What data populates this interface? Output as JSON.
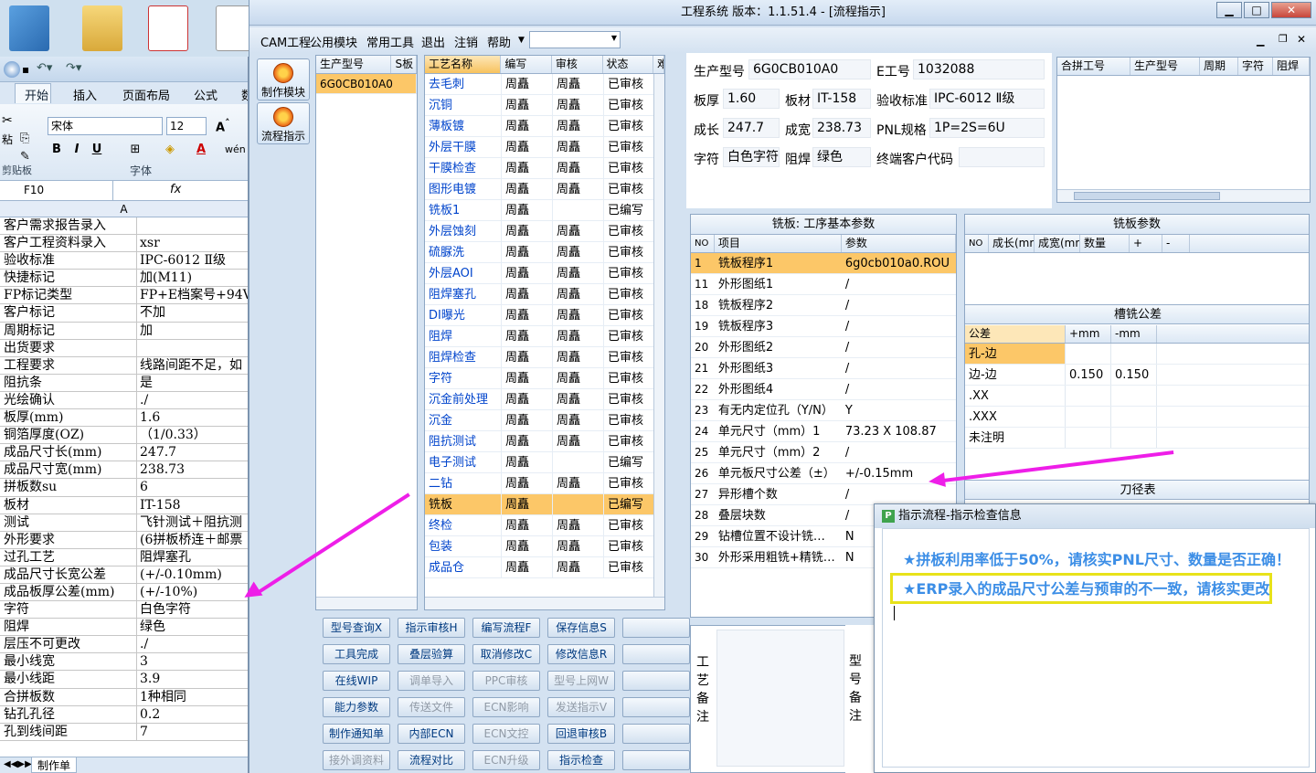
{
  "excel": {
    "font_name": "宋体",
    "font_size": "12",
    "cell_ref": "F10",
    "fx": "fx",
    "col_a": "A",
    "tabs": [
      "开始",
      "插入",
      "页面布局",
      "公式",
      "数"
    ],
    "group_label": "字体",
    "left_label": "剪贴板",
    "paste_label": "粘",
    "sheet_tab": "制作单",
    "rows": [
      [
        "客户需求报告录入",
        ""
      ],
      [
        "客户工程资料录入",
        "xsr"
      ],
      [
        "验收标准",
        "IPC-6012 Ⅱ级"
      ],
      [
        "快捷标记",
        "加(M11)"
      ],
      [
        "FP标记类型",
        "FP+E档案号+94V"
      ],
      [
        "客户标记",
        "不加"
      ],
      [
        "周期标记",
        "加"
      ],
      [
        "出货要求",
        ""
      ],
      [
        "工程要求",
        "线路间距不足，如"
      ],
      [
        "阻抗条",
        "是"
      ],
      [
        "光绘确认",
        "./"
      ],
      [
        "板厚(mm)",
        "1.6"
      ],
      [
        "铜箔厚度(OZ)",
        "（1/0.33）"
      ],
      [
        "成品尺寸长(mm)",
        "247.7"
      ],
      [
        "成品尺寸宽(mm)",
        "238.73"
      ],
      [
        "拼板数su",
        "6"
      ],
      [
        "板材",
        "IT-158"
      ],
      [
        "测试",
        "飞针测试＋阻抗测"
      ],
      [
        "外形要求",
        "(6拼板桥连＋邮票"
      ],
      [
        "过孔工艺",
        "阻焊塞孔"
      ],
      [
        "成品尺寸长宽公差",
        "(+/-0.10mm)"
      ],
      [
        "成品板厚公差(mm)",
        "(+/-10%)"
      ],
      [
        "字符",
        "白色字符"
      ],
      [
        "阻焊",
        "绿色"
      ],
      [
        "层压不可更改",
        "./"
      ],
      [
        "最小线宽",
        "3"
      ],
      [
        "最小线距",
        "3.9"
      ],
      [
        "合拼板数",
        "1种相同"
      ],
      [
        "钻孔孔径",
        "0.2"
      ],
      [
        "孔到线间距",
        "7"
      ]
    ]
  },
  "app": {
    "title": "工程系统   版本：1.1.51.4 - [流程指示]",
    "menu": [
      "CAM工程",
      "公用模块",
      "常用工具",
      "退出",
      "注销",
      "帮助"
    ],
    "sidebar": [
      "制作模块",
      "流程指示"
    ],
    "model_grid": {
      "headers": [
        "生产型号",
        "S板"
      ],
      "rows": [
        [
          "6G0CB010A0",
          ""
        ]
      ]
    },
    "process_grid": {
      "headers": [
        "工艺名称",
        "编写",
        "审核",
        "状态",
        "难"
      ],
      "rows": [
        [
          "去毛刺",
          "周矗",
          "周矗",
          "已审核"
        ],
        [
          "沉铜",
          "周矗",
          "周矗",
          "已审核"
        ],
        [
          "薄板镀",
          "周矗",
          "周矗",
          "已审核"
        ],
        [
          "外层干膜",
          "周矗",
          "周矗",
          "已审核"
        ],
        [
          "干膜检查",
          "周矗",
          "周矗",
          "已审核"
        ],
        [
          "图形电镀",
          "周矗",
          "周矗",
          "已审核"
        ],
        [
          "铣板1",
          "周矗",
          "",
          "已编写"
        ],
        [
          "外层蚀刻",
          "周矗",
          "周矗",
          "已审核"
        ],
        [
          "硫脲洗",
          "周矗",
          "周矗",
          "已审核"
        ],
        [
          "外层AOI",
          "周矗",
          "周矗",
          "已审核"
        ],
        [
          "阻焊塞孔",
          "周矗",
          "周矗",
          "已审核"
        ],
        [
          "DI曝光",
          "周矗",
          "周矗",
          "已审核"
        ],
        [
          "阻焊",
          "周矗",
          "周矗",
          "已审核"
        ],
        [
          "阻焊检查",
          "周矗",
          "周矗",
          "已审核"
        ],
        [
          "字符",
          "周矗",
          "周矗",
          "已审核"
        ],
        [
          "沉金前处理",
          "周矗",
          "周矗",
          "已审核"
        ],
        [
          "沉金",
          "周矗",
          "周矗",
          "已审核"
        ],
        [
          "阻抗测试",
          "周矗",
          "周矗",
          "已审核"
        ],
        [
          "电子测试",
          "周矗",
          "",
          "已编写"
        ],
        [
          "二钻",
          "周矗",
          "周矗",
          "已审核"
        ],
        [
          "铣板",
          "周矗",
          "",
          "已编写"
        ],
        [
          "终检",
          "周矗",
          "周矗",
          "已审核"
        ],
        [
          "包装",
          "周矗",
          "周矗",
          "已审核"
        ],
        [
          "成品仓",
          "周矗",
          "周矗",
          "已审核"
        ]
      ],
      "selected_index": 20
    },
    "buttons": [
      [
        [
          "型号查询X",
          false
        ],
        [
          "指示审核H",
          false
        ],
        [
          "编写流程F",
          false
        ],
        [
          "保存信息S",
          false
        ],
        [
          "",
          false
        ]
      ],
      [
        [
          "工具完成",
          false
        ],
        [
          "叠层验算",
          false
        ],
        [
          "取消修改C",
          false
        ],
        [
          "修改信息R",
          false
        ],
        [
          "",
          false
        ]
      ],
      [
        [
          "在线WIP",
          false
        ],
        [
          "调单导入",
          true
        ],
        [
          "PPC审核",
          true
        ],
        [
          "型号上网W",
          true
        ],
        [
          "",
          false
        ]
      ],
      [
        [
          "能力参数",
          false
        ],
        [
          "传送文件",
          true
        ],
        [
          "ECN影响",
          true
        ],
        [
          "发送指示V",
          true
        ],
        [
          "",
          false
        ]
      ],
      [
        [
          "制作通知单",
          false
        ],
        [
          "内部ECN",
          false
        ],
        [
          "ECN文控",
          true
        ],
        [
          "回退审核B",
          false
        ],
        [
          "",
          false
        ]
      ],
      [
        [
          "接外调资料",
          true
        ],
        [
          "流程对比",
          false
        ],
        [
          "ECN升级",
          true
        ],
        [
          "指示检查",
          false
        ],
        [
          "",
          false
        ]
      ]
    ],
    "info": {
      "model_label": "生产型号",
      "model": "6G0CB010A0",
      "eno_label": "E工号",
      "eno": "1032088",
      "thick_label": "板厚",
      "thick": "1.60",
      "mat_label": "板材",
      "mat": "IT-158",
      "std_label": "验收标准",
      "std": "IPC-6012 Ⅱ级",
      "len_label": "成长",
      "len": "247.7",
      "wid_label": "成宽",
      "wid": "238.73",
      "pnl_label": "PNL规格",
      "pnl": "1P=2S=6U",
      "char_label": "字符",
      "char": "白色字符",
      "mask_label": "阻焊",
      "mask": "绿色",
      "cust_label": "终端客户代码",
      "cust": ""
    },
    "merge_grid": {
      "headers": [
        "合拼工号",
        "生产型号",
        "周期",
        "字符",
        "阻焊"
      ]
    },
    "basic_params": {
      "caption": "铣板: 工序基本参数",
      "headers": [
        "NO",
        "项目",
        "参数"
      ],
      "rows": [
        [
          "1",
          "铣板程序1",
          "6g0cb010a0.ROU"
        ],
        [
          "11",
          "外形图纸1",
          "/"
        ],
        [
          "18",
          "铣板程序2",
          "/"
        ],
        [
          "19",
          "铣板程序3",
          "/"
        ],
        [
          "20",
          "外形图纸2",
          "/"
        ],
        [
          "21",
          "外形图纸3",
          "/"
        ],
        [
          "22",
          "外形图纸4",
          "/"
        ],
        [
          "23",
          "有无内定位孔（Y/N）",
          "Y"
        ],
        [
          "24",
          "单元尺寸（mm）1",
          "73.23 X 108.87"
        ],
        [
          "25",
          "单元尺寸（mm）2",
          "/"
        ],
        [
          "26",
          "单元板尺寸公差（±）",
          "+/-0.15mm"
        ],
        [
          "27",
          "异形槽个数",
          "/"
        ],
        [
          "28",
          "叠层块数",
          "/"
        ],
        [
          "29",
          "钻槽位置不设计铣…",
          "N"
        ],
        [
          "30",
          "外形采用粗铣+精铣…",
          "N"
        ]
      ]
    },
    "mill_params": {
      "caption": "铣板参数",
      "headers": [
        "NO",
        "成长(mm)",
        "成宽(mm)",
        "数量",
        "+",
        "-"
      ]
    },
    "slot_tol": {
      "caption": "槽铣公差",
      "headers": [
        "公差",
        "+mm",
        "-mm"
      ],
      "rows": [
        [
          "孔-边",
          "",
          ""
        ],
        [
          "边-边",
          "0.150",
          "0.150"
        ],
        [
          ".XX",
          "",
          ""
        ],
        [
          ".XXX",
          "",
          ""
        ],
        [
          "未注明",
          "",
          ""
        ]
      ]
    },
    "tool_table": {
      "caption": "刀径表"
    },
    "remarks": {
      "process": "工艺备注",
      "model": "型号备注"
    }
  },
  "popup": {
    "title": "指示流程-指示检查信息",
    "messages": [
      "★拼板利用率低于50%，请核实PNL尺寸、数量是否正确！",
      "★ERP录入的成品尺寸公差与预审的不一致，请核实更改"
    ]
  },
  "colors": {
    "selected_row": "#fcc768",
    "accent_link": "#0044cc",
    "arrow": "#ee1ee8",
    "highlight_box": "#e8e21a"
  }
}
